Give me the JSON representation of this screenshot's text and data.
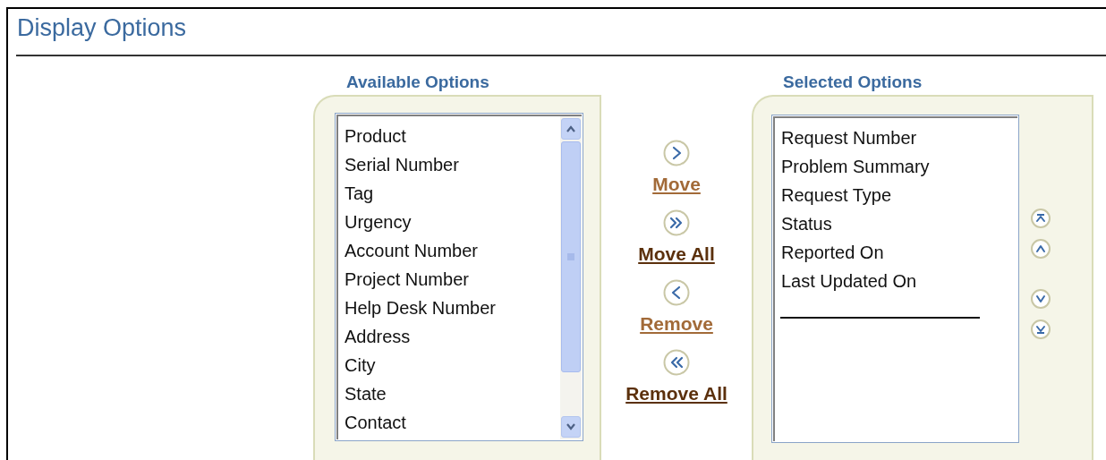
{
  "page_title": "Display Options",
  "available": {
    "label": "Available Options",
    "items": [
      "Product",
      "Serial Number",
      "Tag",
      "Urgency",
      "Account Number",
      "Project Number",
      "Help Desk Number",
      "Address",
      "City",
      "State",
      "Contact"
    ]
  },
  "actions": [
    {
      "kind": "move",
      "label": "Move",
      "disabled": true
    },
    {
      "kind": "move_all",
      "label": "Move All",
      "disabled": false
    },
    {
      "kind": "remove",
      "label": "Remove",
      "disabled": true
    },
    {
      "kind": "remove_all",
      "label": "Remove All",
      "disabled": false
    }
  ],
  "selected": {
    "label": "Selected Options",
    "items": [
      "Request Number",
      "Problem Summary",
      "Request Type",
      "Status",
      "Reported On",
      "Last Updated On"
    ]
  }
}
